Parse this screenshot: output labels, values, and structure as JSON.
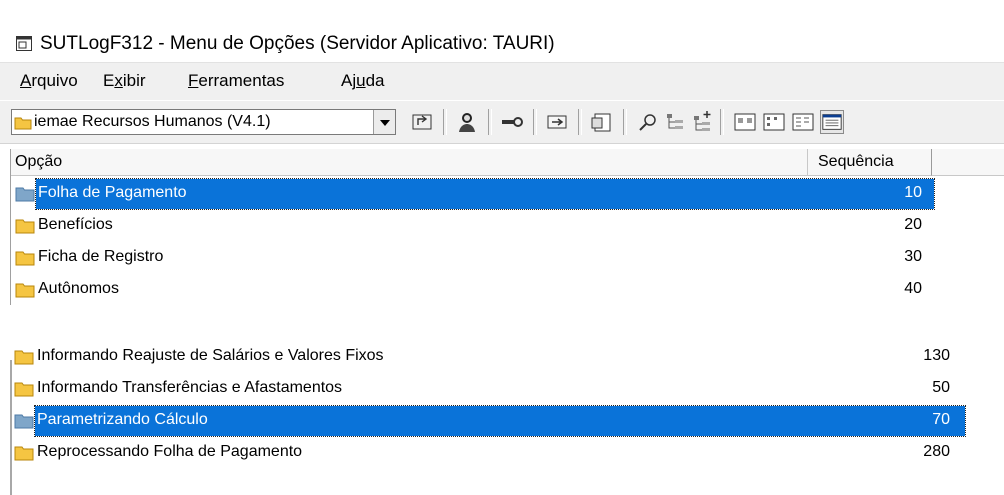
{
  "window": {
    "title": "SUTLogF312 - Menu de Opções (Servidor Aplicativo: TAURI)"
  },
  "menubar": {
    "items": [
      {
        "label": "Arquivo",
        "accel": "A",
        "rest": "rquivo"
      },
      {
        "label": "Exibir",
        "pre": "E",
        "accel": "x",
        "rest": "ibir"
      },
      {
        "label": "Ferramentas",
        "accel": "F",
        "rest": "erramentas"
      },
      {
        "label": "Ajuda",
        "pre": "Aj",
        "accel": "u",
        "rest": "da"
      }
    ]
  },
  "toolbar": {
    "system_combo_value": "iemae Recursos Humanos (V4.1)",
    "buttons": [
      "up-folder-icon",
      "user-icon",
      "key-icon",
      "run-icon",
      "properties-icon",
      "find-icon",
      "tree-icon",
      "tree-add-icon",
      "large-icons-view-icon",
      "small-icons-view-icon",
      "list-view-icon",
      "details-view-icon"
    ]
  },
  "list": {
    "columns": [
      "Opção",
      "Sequência"
    ],
    "rows": [
      {
        "label": "Folha de Pagamento",
        "seq": "10",
        "selected": true
      },
      {
        "label": "Benefícios",
        "seq": "20",
        "selected": false
      },
      {
        "label": "Ficha de Registro",
        "seq": "30",
        "selected": false
      },
      {
        "label": "Autônomos",
        "seq": "40",
        "selected": false
      }
    ]
  },
  "fragment": {
    "rows": [
      {
        "label": "Informando Reajuste de Salários e Valores Fixos",
        "seq": "130",
        "selected": false
      },
      {
        "label": "Informando Transferências e Afastamentos",
        "seq": "50",
        "selected": false
      },
      {
        "label": "Parametrizando Cálculo",
        "seq": "70",
        "selected": true
      },
      {
        "label": "Reprocessando Folha de Pagamento",
        "seq": "280",
        "selected": false
      }
    ]
  },
  "colors": {
    "selection": "#0a73d9",
    "folder": "#f5c542",
    "folder_open": "#7fa6c9"
  }
}
